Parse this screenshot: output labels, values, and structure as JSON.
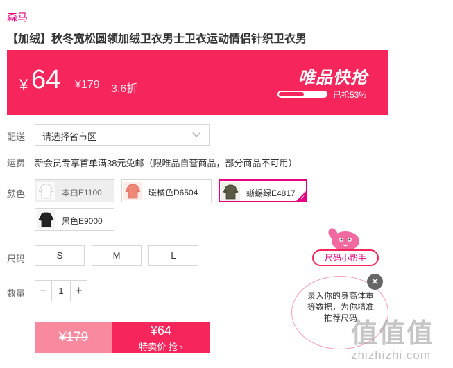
{
  "brand": "森马",
  "title": "【加绒】秋冬宽松圆领加绒卫衣男士卫衣运动情侣针织卫衣男",
  "banner": {
    "currency": "¥",
    "price": "64",
    "original_price": "¥179",
    "discount": "3.6折",
    "vip_label": "唯品快抢",
    "grabbed_text": "已抢53%",
    "grabbed_fraction": 0.53,
    "color": "#f6265d"
  },
  "delivery": {
    "label": "配送",
    "placeholder": "请选择省市区",
    "icon": "chevron-down-icon"
  },
  "shipping": {
    "label": "运费",
    "text": "新会员专享首单满38元免邮（限唯品自营商品，部分商品不可用）"
  },
  "colors": {
    "label": "颜色",
    "options": [
      {
        "name": "本白E1100",
        "state": "disabled"
      },
      {
        "name": "暖橘色D6504",
        "state": "normal"
      },
      {
        "name": "蜥蜴绿E4817",
        "state": "selected"
      },
      {
        "name": "黑色E9000",
        "state": "normal"
      }
    ],
    "accent": "#e4007f"
  },
  "sizes": {
    "label": "尺码",
    "options": [
      "S",
      "M",
      "L"
    ]
  },
  "quantity": {
    "label": "数量",
    "value": "1",
    "minus": "−",
    "plus": "+"
  },
  "buy": {
    "original_price": "¥179",
    "price": "¥64",
    "action": "特卖价 抢 ›"
  },
  "helper": {
    "pill": "尺码小帮手",
    "bubble": "录入你的身高体重等数据，为你精准推荐尺码",
    "close": "✕"
  },
  "watermark": {
    "text": "值值值",
    "url": "zhizhizhi.com"
  }
}
